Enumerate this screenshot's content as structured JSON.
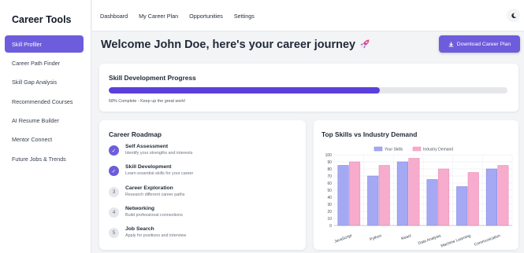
{
  "app": {
    "title": "Career Tools"
  },
  "sidebar": {
    "items": [
      {
        "label": "Skill Profiler",
        "active": true
      },
      {
        "label": "Career Path Finder"
      },
      {
        "label": "Skill Gap Analysis"
      },
      {
        "label": "Recommended Courses"
      },
      {
        "label": "AI Resume Builder"
      },
      {
        "label": "Mentor Connect"
      },
      {
        "label": "Future Jobs & Trends"
      }
    ]
  },
  "topnav": {
    "items": [
      {
        "label": "Dashboard"
      },
      {
        "label": "My Career Plan"
      },
      {
        "label": "Opportunities"
      },
      {
        "label": "Settings"
      }
    ],
    "theme_icon": "moon-icon"
  },
  "header": {
    "title": "Welcome John Doe, here's your career journey",
    "emoji": "rocket-icon",
    "download_label": "Download Career Plan"
  },
  "progress": {
    "title": "Skill Development Progress",
    "percent": 68,
    "note": "68% Complete - Keep up the great work!"
  },
  "roadmap": {
    "title": "Career Roadmap",
    "steps": [
      {
        "marker": "✓",
        "status": "done",
        "title": "Self Assessment",
        "desc": "Identify your strengths and interests"
      },
      {
        "marker": "✓",
        "status": "done",
        "title": "Skill Development",
        "desc": "Learn essential skills for your career"
      },
      {
        "marker": "3",
        "status": "todo",
        "title": "Career Exploration",
        "desc": "Research different career paths"
      },
      {
        "marker": "4",
        "status": "todo",
        "title": "Networking",
        "desc": "Build professional connections"
      },
      {
        "marker": "5",
        "status": "todo",
        "title": "Job Search",
        "desc": "Apply for positions and interview"
      }
    ]
  },
  "colors": {
    "accent": "#6d5ddc",
    "progress": "#5b3fdb",
    "your_skills": "#a5a8f3",
    "industry_demand": "#f7abcd"
  },
  "chart_data": {
    "type": "bar",
    "title": "Top Skills vs Industry Demand",
    "categories": [
      "JavaScript",
      "Python",
      "React",
      "Data Analysis",
      "Machine Learning",
      "Communication"
    ],
    "series": [
      {
        "name": "Your Skills",
        "values": [
          85,
          70,
          90,
          65,
          55,
          80
        ]
      },
      {
        "name": "Industry Demand",
        "values": [
          90,
          85,
          95,
          80,
          75,
          85
        ]
      }
    ],
    "ylim": [
      0,
      100
    ],
    "yticks": [
      "0",
      "10",
      "20",
      "30",
      "40",
      "50",
      "60",
      "70",
      "80",
      "90",
      "100"
    ],
    "legend": "top",
    "grid": true
  }
}
